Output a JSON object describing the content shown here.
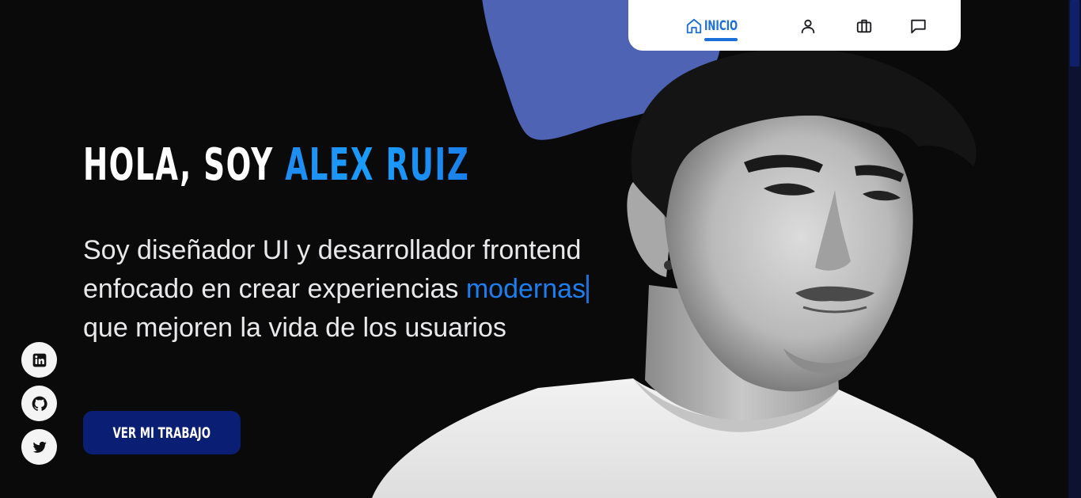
{
  "nav": {
    "items": [
      {
        "label": "INICIO",
        "icon": "home-icon",
        "active": true
      },
      {
        "label": "",
        "icon": "user-icon"
      },
      {
        "label": "",
        "icon": "briefcase-icon"
      },
      {
        "label": "",
        "icon": "chat-icon"
      }
    ]
  },
  "hero": {
    "greeting": "HOLA, SOY ",
    "name": "ALEX RUIZ",
    "desc_before": "Soy diseñador UI y desarrollador frontend enfocado en crear experiencias ",
    "desc_highlight": "modernas",
    "desc_after": " que mejoren la vida de los usuarios",
    "cta_label": "VER MI TRABAJO"
  },
  "social": [
    {
      "icon": "linkedin-icon"
    },
    {
      "icon": "github-icon"
    },
    {
      "icon": "twitter-icon"
    }
  ],
  "colors": {
    "background": "#0a0a0b",
    "accent": "#1a6fd8",
    "blob": "#4f63b4",
    "cta": "#0a1f73"
  }
}
